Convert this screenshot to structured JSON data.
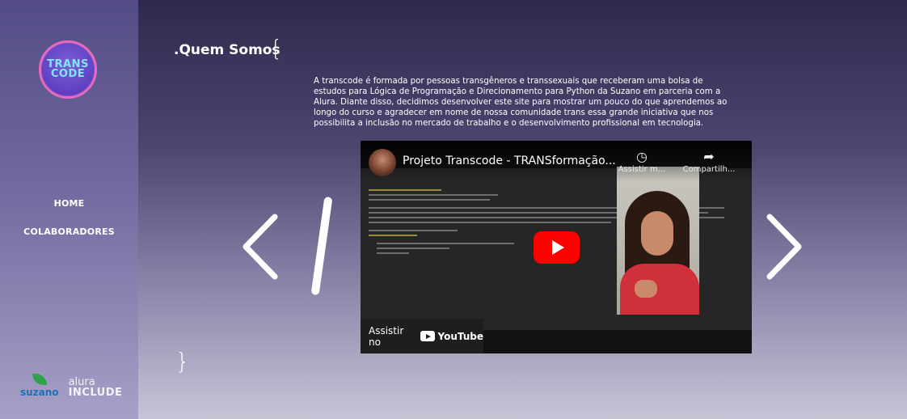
{
  "sidebar": {
    "logo": {
      "line1": "TRANS",
      "line2": "CODE"
    },
    "nav": [
      {
        "label": "HOME"
      },
      {
        "label": "COLABORADORES"
      }
    ],
    "sponsors": {
      "suzano": "suzano",
      "alura_top": "alura",
      "alura_bottom": "INCLUDE"
    }
  },
  "main": {
    "heading": ".Quem Somos",
    "brace_open": "{",
    "brace_close": "}",
    "about_text": "A transcode é formada por pessoas transgêneros e transsexuais que receberam uma bolsa de estudos para Lógica de Programação e Direcionamento para Python da Suzano em parceria com a Alura. Diante disso, decidimos desenvolver este site para mostrar um pouco do que aprendemos ao longo do curso e agradecer em nome de nossa comunidade trans essa grande iniciativa que nos possibilita a inclusão no mercado de trabalho e o desenvolvimento profissional em tecnologia.",
    "video": {
      "title": "Projeto Transcode - TRANSformação...",
      "watch_later": "Assistir m...",
      "share": "Compartilh...",
      "watch_on": "Assistir no",
      "youtube": "YouTube"
    }
  },
  "colors": {
    "accent": "#e86ac0",
    "logo_text": "#7ee6ff",
    "youtube_red": "#ff0000"
  },
  "icons": [
    "chevron-left-icon",
    "chevron-right-icon",
    "play-icon",
    "clock-icon",
    "share-icon"
  ]
}
